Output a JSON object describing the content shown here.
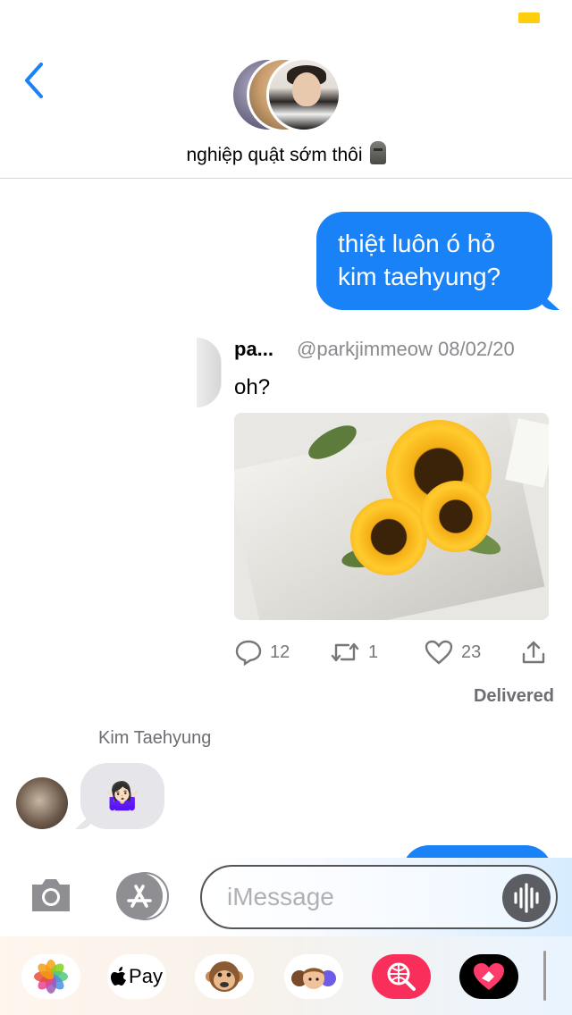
{
  "header": {
    "back_icon": "chevron-left-icon",
    "chat_title": "nghiệp quật sớm thôi",
    "title_emoji": "moai-emoji",
    "accent_color": "#1a82f7"
  },
  "messages": {
    "outgoing_1": {
      "line1": "thiệt luôn ó hỏ",
      "line2": "kim taehyung?"
    },
    "tweet": {
      "name": "pa...",
      "handle": "@parkjimmeow",
      "date": "08/02/20",
      "text": "oh?",
      "replies": "12",
      "retweets": "1",
      "likes": "23"
    },
    "status": "Delivered",
    "incoming": {
      "sender": "Kim Taehyung",
      "emoji": "🤷🏻‍♀️"
    }
  },
  "input_bar": {
    "placeholder": "iMessage"
  },
  "app_drawer": {
    "apps": [
      {
        "name": "photos-app"
      },
      {
        "name": "apple-pay-app",
        "label": "Pay"
      },
      {
        "name": "animoji-app"
      },
      {
        "name": "memoji-app"
      },
      {
        "name": "web-search-app"
      },
      {
        "name": "digital-touch-app"
      }
    ]
  }
}
